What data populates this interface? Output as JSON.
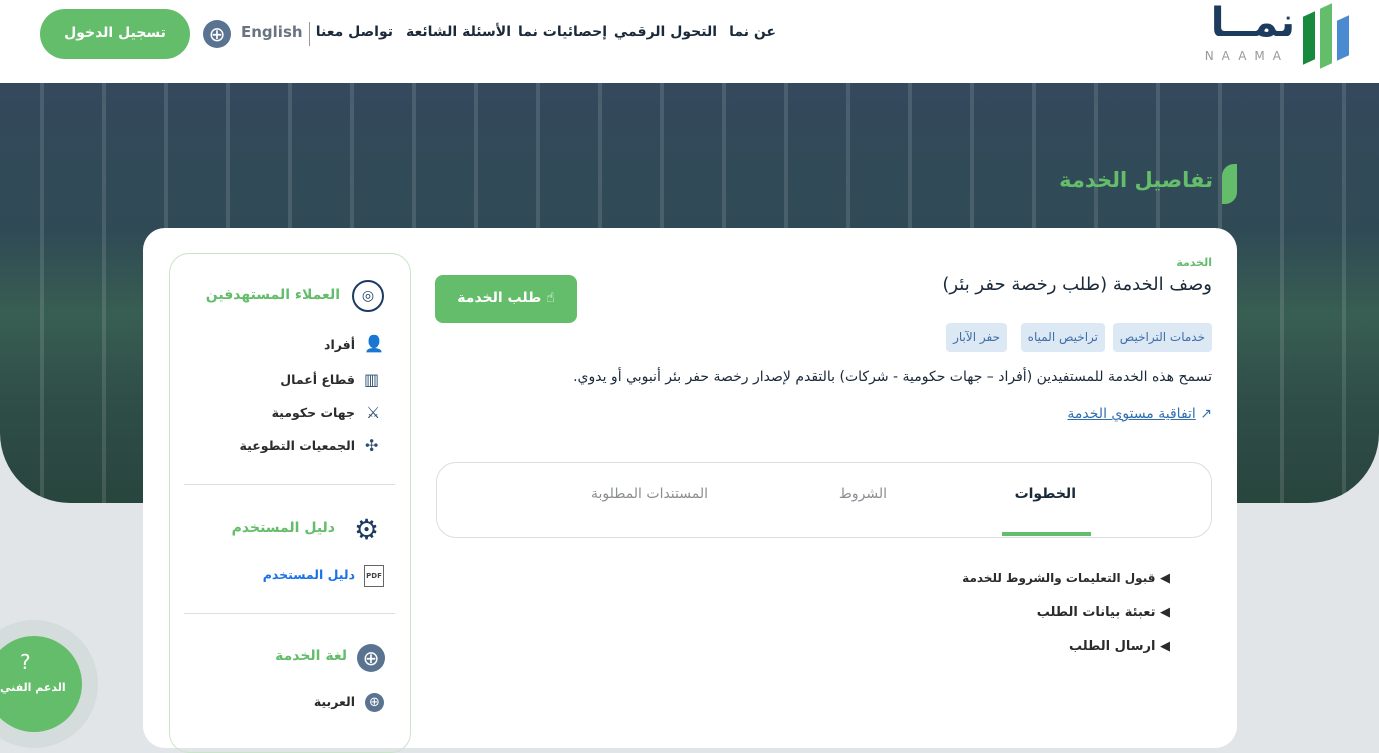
{
  "header": {
    "logo_text": "نمــا",
    "logo_latin": "NAAMA",
    "nav": [
      "عن نما",
      "التحول الرقمي",
      "إحصائيات نما",
      "الأسئلة الشائعة",
      "تواصل معنا"
    ],
    "language": "English",
    "login": "تسجيل الدخول"
  },
  "hero": {
    "title": "تفاصيل الخدمة"
  },
  "service": {
    "label": "الخدمة",
    "title": "وصف الخدمة (طلب رخصة حفر بئر)",
    "request_button": "طلب الخدمة",
    "tags": [
      "خدمات التراخيص",
      "تراخيص المياه",
      "حفر الآبار"
    ],
    "description": "تسمح هذه الخدمة للمستفيدين (أفراد – جهات حكومية - شركات) بالتقدم لإصدار رخصة حفر بئر أنبوبي أو يدوي.",
    "sla_link": "اتفاقية مستوي الخدمة"
  },
  "tabs": [
    "الخطوات",
    "الشروط",
    "المستندات المطلوبة"
  ],
  "steps": [
    "قبول التعليمات والشروط للخدمة",
    "تعبئة بيانات الطلب",
    "ارسال الطلب"
  ],
  "sidebar": {
    "customers_title": "العملاء المستهدفين",
    "customers": [
      "أفراد",
      "قطاع أعمال",
      "جهات حكومية",
      "الجمعيات التطوعية"
    ],
    "guide_title": "دليل المستخدم",
    "guide_link": "دليل المستخدم",
    "lang_title": "لغة الخدمة",
    "lang": "العربية"
  },
  "support": {
    "label": "الدعم الفني"
  },
  "colors": {
    "green": "#63bd6a",
    "navy": "#1d3a5f",
    "link": "#2f6fb0"
  }
}
